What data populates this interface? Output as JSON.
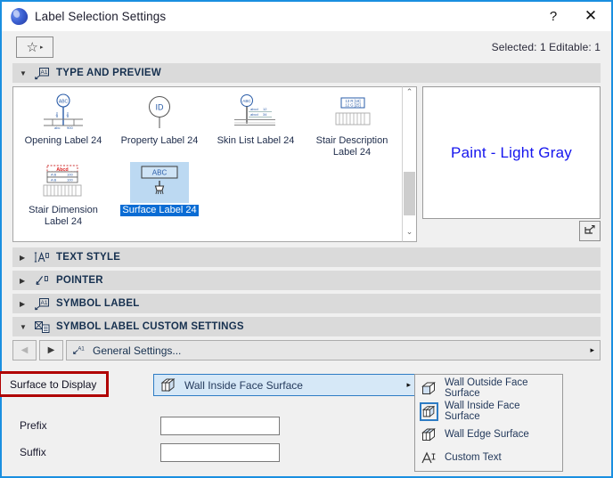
{
  "window": {
    "title": "Label Selection Settings",
    "app_icon": "archicad-drop-icon",
    "help_label": "?",
    "close_label": "✕"
  },
  "toolbar": {
    "favorites_icon": "star-icon",
    "favorites_caret": "▸",
    "status": "Selected: 1 Editable: 1"
  },
  "sections": {
    "type_and_preview": {
      "title": "TYPE AND PREVIEW",
      "triangle": "▼",
      "icon": "label-a1-icon",
      "expanded": true
    },
    "text_style": {
      "title": "TEXT STYLE",
      "triangle": "▶",
      "icon": "text-style-icon",
      "expanded": false
    },
    "pointer": {
      "title": "POINTER",
      "triangle": "▶",
      "icon": "pointer-arrow-icon",
      "expanded": false
    },
    "symbol_label": {
      "title": "SYMBOL LABEL",
      "triangle": "▶",
      "icon": "symbol-label-icon",
      "expanded": false
    },
    "symbol_label_custom": {
      "title": "SYMBOL LABEL CUSTOM SETTINGS",
      "triangle": "▼",
      "icon": "custom-settings-icon",
      "expanded": true
    }
  },
  "type_list": {
    "items": [
      {
        "label": "Opening Label 24",
        "icon": "opening-label-thumb",
        "selected": false
      },
      {
        "label": "Property Label 24",
        "icon": "property-label-thumb",
        "selected": false
      },
      {
        "label": "Skin List Label 24",
        "icon": "skin-list-label-thumb",
        "selected": false
      },
      {
        "label": "Stair Description Label 24",
        "icon": "stair-description-label-thumb",
        "selected": false
      },
      {
        "label": "Stair Dimension Label 24",
        "icon": "stair-dimension-label-thumb",
        "selected": false
      },
      {
        "label": "Surface Label 24",
        "icon": "surface-label-thumb",
        "selected": true
      }
    ],
    "scrollbar": {
      "up_arrow": "⌃",
      "down_arrow": "⌄"
    }
  },
  "preview": {
    "text": "Paint - Light Gray",
    "text_color": "#1515ee",
    "view_button_icon": "3d-view-icon"
  },
  "navigation": {
    "back_arrow": "◀",
    "forward_arrow": "▶",
    "page_icon": "a1-label-icon",
    "page_label": "General Settings...",
    "overflow_caret": "▸"
  },
  "surface_to_display": {
    "annotation_label": "Surface to Display",
    "annotation_color": "#b00000",
    "selected_value": "Wall Inside Face Surface",
    "selected_icon": "wall-inside-face-icon",
    "caret": "▸"
  },
  "dropdown": {
    "options": [
      {
        "label": "Wall Outside Face Surface",
        "icon": "wall-outside-face-icon",
        "selected": false
      },
      {
        "label": "Wall Inside Face Surface",
        "icon": "wall-inside-face-icon",
        "selected": true
      },
      {
        "label": "Wall Edge Surface",
        "icon": "wall-edge-face-icon",
        "selected": false
      },
      {
        "label": "Custom Text",
        "icon": "custom-text-icon",
        "selected": false
      }
    ]
  },
  "fields": {
    "prefix": {
      "label": "Prefix",
      "value": "",
      "placeholder": ""
    },
    "suffix": {
      "label": "Suffix",
      "value": "",
      "placeholder": ""
    }
  },
  "colors": {
    "accent_blue": "#1a8fe0",
    "section_header_bg": "#dadada",
    "selection_blue": "#0a6cd4",
    "thumb_selected_bg": "#bcd9f2",
    "annotation_red": "#b00000",
    "combo_bg": "#d6e8f7"
  }
}
